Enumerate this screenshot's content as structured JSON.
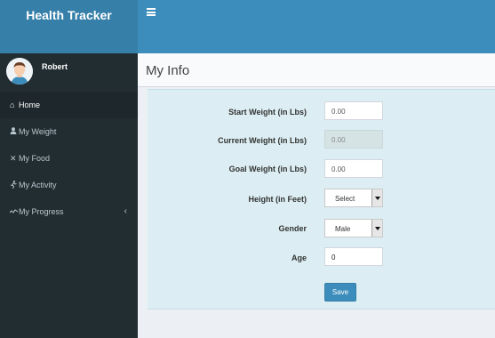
{
  "app": {
    "title": "Health Tracker"
  },
  "user": {
    "name": "Robert"
  },
  "sidebar": {
    "items": [
      {
        "label": "Home",
        "icon": "home-icon",
        "glyph": "⌂",
        "active": true
      },
      {
        "label": "My Weight",
        "icon": "user-icon",
        "glyph": "👤"
      },
      {
        "label": "My Food",
        "icon": "cutlery-icon",
        "glyph": "✕"
      },
      {
        "label": "My Activity",
        "icon": "running-icon",
        "glyph": "⚲"
      },
      {
        "label": "My Progress",
        "icon": "line-chart-icon",
        "glyph": "〰",
        "chevron": "‹"
      }
    ]
  },
  "page": {
    "title": "My Info"
  },
  "form": {
    "start_weight": {
      "label": "Start Weight (in Lbs)",
      "value": "0.00"
    },
    "current_weight": {
      "label": "Current Weight (in Lbs)",
      "value": "0.00"
    },
    "goal_weight": {
      "label": "Goal Weight (in Lbs)",
      "value": "0.00"
    },
    "height": {
      "label": "Height (in Feet)",
      "value": "Select"
    },
    "gender": {
      "label": "Gender",
      "value": "Male"
    },
    "age": {
      "label": "Age",
      "value": "0"
    },
    "save_label": "Save"
  }
}
